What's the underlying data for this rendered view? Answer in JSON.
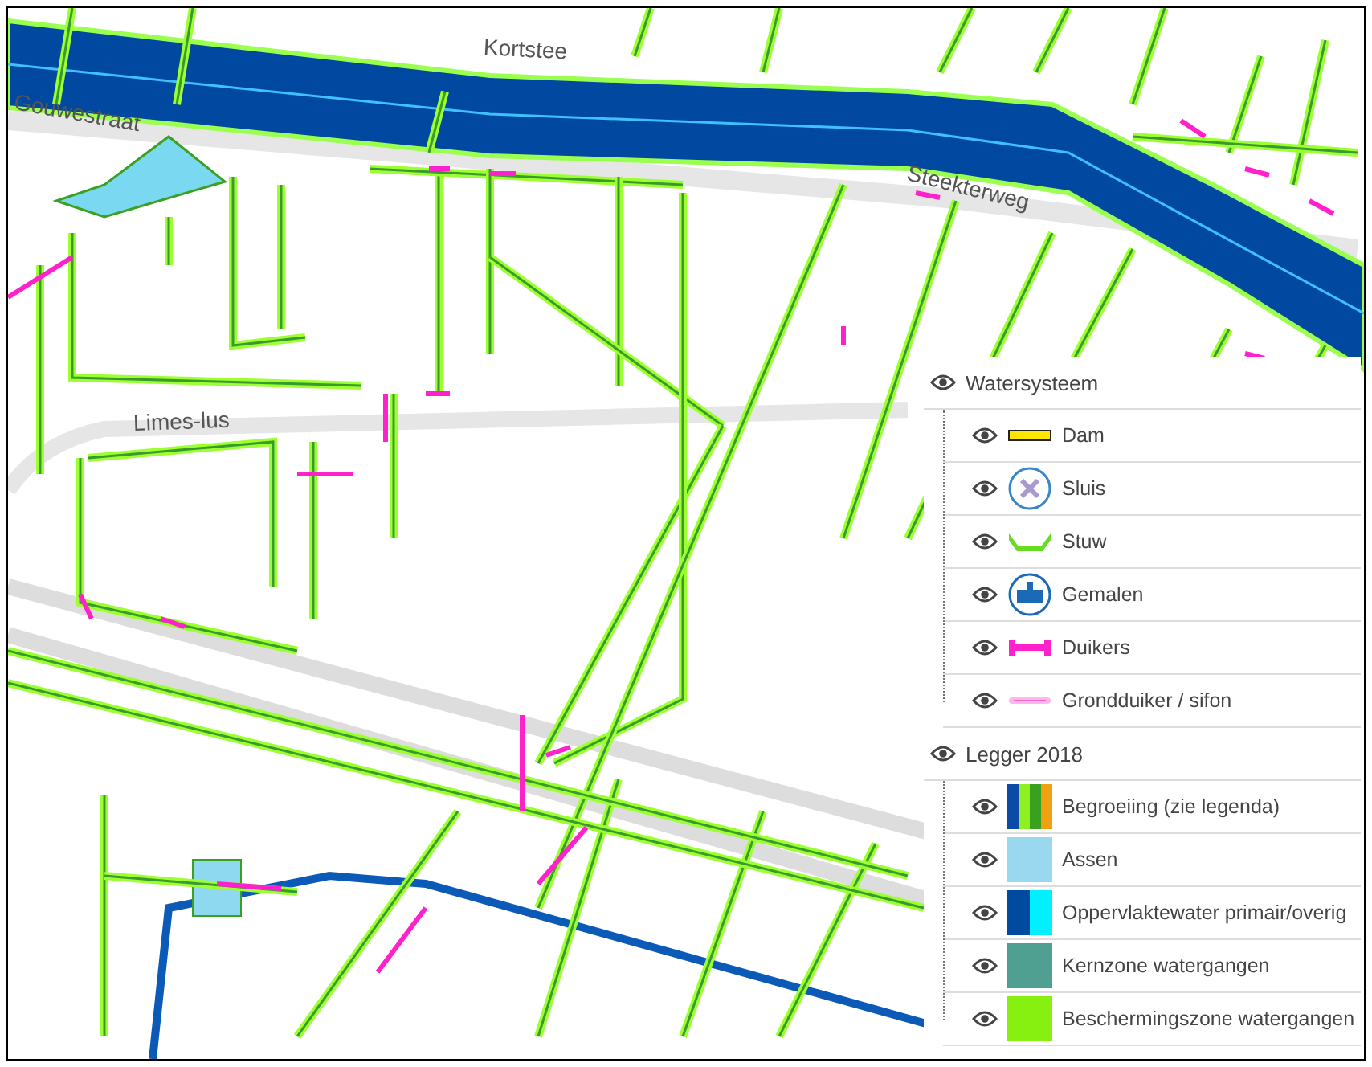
{
  "map": {
    "labels": [
      {
        "text": "Kortstee"
      },
      {
        "text": "Gouwestraat"
      },
      {
        "text": "Steekterweg"
      },
      {
        "text": "Limes-lus"
      }
    ]
  },
  "legend": {
    "groups": [
      {
        "title": "Watersysteem",
        "items": [
          {
            "kind": "dam",
            "label": "Dam"
          },
          {
            "kind": "sluis",
            "label": "Sluis"
          },
          {
            "kind": "stuw",
            "label": "Stuw"
          },
          {
            "kind": "gemaal",
            "label": "Gemalen"
          },
          {
            "kind": "duiker",
            "label": "Duikers"
          },
          {
            "kind": "grondduiker",
            "label": "Grondduiker / sifon"
          }
        ]
      },
      {
        "title": "Legger 2018",
        "items": [
          {
            "kind": "swatch",
            "label": "Begroeiing (zie legenda)",
            "stripes": [
              {
                "color": "#0b4aa6"
              },
              {
                "color": "#8ef022"
              },
              {
                "color": "#3aa020"
              },
              {
                "color": "#f0a010"
              }
            ]
          },
          {
            "kind": "swatch",
            "label": "Assen",
            "stripes": [
              {
                "color": "#9ad8f0"
              }
            ]
          },
          {
            "kind": "swatch",
            "label": "Oppervlaktewater primair/overig",
            "stripes": [
              {
                "color": "#004aa0"
              },
              {
                "color": "#00f0ff"
              }
            ]
          },
          {
            "kind": "swatch",
            "label": "Kernzone watergangen",
            "stripes": [
              {
                "color": "#4fa090"
              }
            ]
          },
          {
            "kind": "swatch",
            "label": "Beschermingszone watergangen",
            "stripes": [
              {
                "color": "#88f010"
              }
            ]
          }
        ]
      }
    ]
  }
}
